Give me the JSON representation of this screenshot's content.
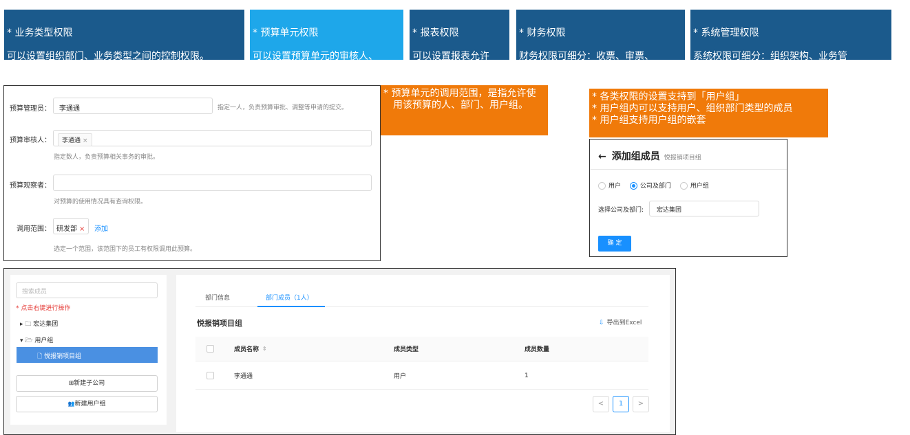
{
  "cards": [
    {
      "title": "* 业务类型权限",
      "body": "可以设置组织部门、业务类型之间的控制权限。\n例如，研发部只能提交特定项目的申请。"
    },
    {
      "title": "* 预算单元权限",
      "body": "可以设置预算单元的审核人、\n管理员、允许被调用的范围。"
    },
    {
      "title": "* 报表权限",
      "body": "可以设置报表允许\n被哪些人查看。"
    },
    {
      "title": "* 财务权限",
      "body": "财务权限可细分：收票、审票、\n出纳。分别对应不同权限。"
    },
    {
      "title": "* 系统管理权限",
      "body": "系统权限可细分：组织架构、业务管\n理、预算管理、系统管理。"
    }
  ],
  "callouts": {
    "scope": "* 预算单元的调用范围，是指允许使用该预算的人、部门、用户组。",
    "usergroup": "* 各类权限的设置支持到「用户组」\n* 用户组内可以支持用户、组织部门类型的成员\n* 用户组支持用户组的嵌套"
  },
  "form": {
    "manager_label": "预算管理员：",
    "manager_value": "李通通",
    "manager_hint": "指定一人，负责预算审批、调整等申请的提交。",
    "reviewer_label": "预算审核人：",
    "reviewer_tag": "李通通",
    "reviewer_tag_close": "×",
    "reviewer_hint": "指定数人，负责预算相关事务的审批。",
    "observer_label": "预算观察者：",
    "observer_hint": "对预算的使用情况具有查询权限。",
    "scope_label": "调用范围：",
    "scope_tag": "研发部",
    "scope_tag_close": "×",
    "scope_add": "添加",
    "scope_hint": "选定一个范围，该范围下的员工有权限调用此预算。"
  },
  "dialog": {
    "back": "←",
    "title": "添加组成员",
    "subtitle": "悦报销项目组",
    "radio_user": "用户",
    "radio_company": "公司及部门",
    "radio_group": "用户组",
    "select_label": "选择公司及部门:",
    "select_value": "宏达集团",
    "confirm": "确 定"
  },
  "tree": {
    "search_placeholder": "搜索成员",
    "tip": "* 点击右键进行操作",
    "item_company": "▸ 🗀 宏达集团",
    "item_usergroup": "▾ 🗁 用户组",
    "item_selected": "🗋 悦报销项目组",
    "btn_new_company": "⊞新建子公司",
    "btn_new_group": "新建用户组",
    "btn_new_group_icon": "👥"
  },
  "detail": {
    "tab_info": "部门信息",
    "tab_members": "部门成员（1人）",
    "group_title": "悦报销项目组",
    "export_icon": "⇩",
    "export_label": "导出到Excel",
    "columns": [
      "成员名称",
      "成员类型",
      "成员数量"
    ],
    "sort_icon": "⇕",
    "rows": [
      {
        "name": "李通通",
        "type": "用户",
        "count": "1"
      }
    ],
    "pager_prev": "<",
    "pager_page": "1",
    "pager_next": ">"
  }
}
